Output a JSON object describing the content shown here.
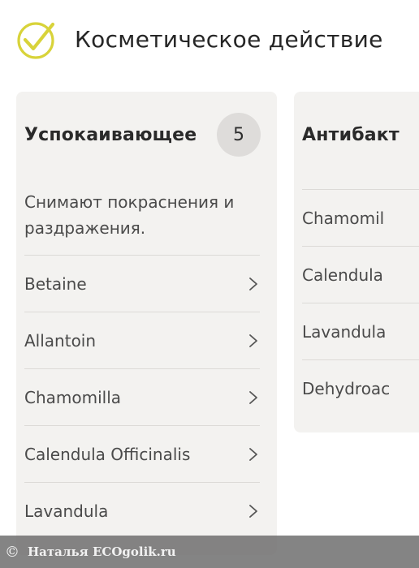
{
  "header": {
    "title": "Косметическое действие",
    "icon": "check-circle-icon",
    "accent_color": "#d8d33a"
  },
  "cards": [
    {
      "title": "Успокаивающее",
      "count": "5",
      "description": "Снимают покраснения и раздражения.",
      "items": [
        {
          "label": "Betaine"
        },
        {
          "label": "Allantoin"
        },
        {
          "label": "Chamomilla"
        },
        {
          "label": "Calendula Officinalis"
        },
        {
          "label": "Lavandula"
        }
      ]
    },
    {
      "title": "Антибакт",
      "items": [
        {
          "label": "Chamomil"
        },
        {
          "label": "Calendula"
        },
        {
          "label": "Lavandula"
        },
        {
          "label": "Dehydroac"
        }
      ]
    }
  ],
  "watermark": {
    "copyright": "©",
    "text": "Наталья  ECOgolik.ru"
  }
}
